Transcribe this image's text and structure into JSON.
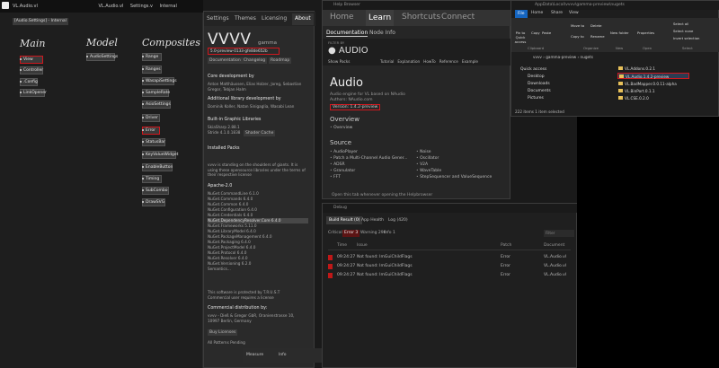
{
  "patch": {
    "tabs": [
      "VL.Audio.vl",
      "VL.Audio.vl",
      "Settings.v",
      "Internal"
    ],
    "path": "[Audio.Settings] - Internal",
    "columns": [
      "Main",
      "Model",
      "Composites"
    ],
    "main_nodes": [
      "View",
      "Controller",
      ".Config",
      "LinkOpener"
    ],
    "model_nodes": [
      "AudioSettings"
    ],
    "composite_nodes": [
      "Range",
      "Ranges",
      "WasapiSettings",
      "SampleRate",
      "AsioSettings",
      "Driver",
      "Error",
      "StatusBar",
      "KeyValueWidget",
      "EnableButton",
      "Timing",
      "SubCombo",
      "DrawSVG"
    ]
  },
  "about": {
    "tabs": [
      "Settings",
      "Themes",
      "Licensing",
      "About"
    ],
    "logo": "VVVV",
    "edition": "gamma",
    "version": "5.0-preview-0133-gfe8de652b",
    "links": [
      "Documentation",
      "Changelog",
      "Roadmap"
    ],
    "core_dev_heading": "Core development by",
    "core_dev": "Anton Matthäussen, Elias Holzer, Joreg, Sebastian Gregor, Tebjan Halm",
    "additional_heading": "Additional library development by",
    "additional": "Dominik Koller, Natan Sinigaglia, Wasabi Lean",
    "graphics_heading": "Built-in Graphic Libraries",
    "graphics": [
      "SkiaSharp   2.88.1",
      "Stride   4.1.0.1838"
    ],
    "shader_cache": "Shader Cache",
    "packs_heading": "Installed Packs",
    "standing": "vvvv is standing on the shoulders of giants. It is using these opensource libraries under the terms of their respective license",
    "license": "Apache-2.0",
    "packages": [
      "NuGet.CommandLine  6.1.0",
      "NuGet.Commands  6.4.0",
      "NuGet.Common  6.4.0",
      "NuGet.Configuration  6.4.0",
      "NuGet.Credentials  6.4.0",
      "NuGet.DependencyResolver.Core  6.4.0",
      "NuGet.Frameworks  5.11.0",
      "NuGet.LibraryModel  6.4.0",
      "NuGet.PackageManagement  6.4.0",
      "NuGet.Packaging  6.4.0",
      "NuGet.ProjectModel  6.4.0",
      "NuGet.Protocol  6.4.0",
      "NuGet.Resolver  6.4.0",
      "NuGet.Versioning  6.2.0",
      "Semantics..."
    ],
    "protected": "This software is protected by T.R.U.S.T",
    "commercial": "Commercial user requires a license",
    "distribution_heading": "Commercial distribution by:",
    "distribution": "vvvv - Dieß & Gregor GbR, Oranienstrasse 10, 10997 Berlin, Germany",
    "buy": "Buy Licenses",
    "patterns": "All Patterns Pending"
  },
  "help": {
    "window_title": "Help Browser",
    "nav": [
      "Home",
      "Learn",
      "Shortcuts",
      "Connect"
    ],
    "subnav": [
      "Documentation",
      "Node Info"
    ],
    "filtered_label": "FILTER BY",
    "filter_title": "AUDIO",
    "filter_sub": "Show Packs",
    "filter_tags": [
      "Tutorial",
      "Explanation",
      "HowTo",
      "Reference",
      "Example"
    ],
    "title": "Audio",
    "desc1": "Audio engine for VL based on NAudio",
    "desc2": "Authors: NAudio.com",
    "version": "Version: 1.4.2-preview",
    "overview_heading": "Overview",
    "overview_item": "Overview",
    "source_heading": "Source",
    "source_left": [
      "AudioPlayer",
      "Patch a Multi-Channel Audio Gener...",
      "ADSR",
      "Granulator",
      "FFT"
    ],
    "source_right": [
      "Noise",
      "Oscillator",
      "V2A",
      "WaveTable",
      "StepSequencer and ValueSequence"
    ],
    "footer": "Open this tab whenever opening the Helpbrowser"
  },
  "debug": {
    "window_title": "Debug",
    "tabs": [
      "Build Result (0)",
      "App Health",
      "Log (420)"
    ],
    "filters": [
      "Critical",
      "Error 3",
      "Warning 290",
      "Info 1"
    ],
    "search_placeholder": "Filter",
    "columns": [
      "Time",
      "Issue",
      "Patch",
      "Document"
    ],
    "rows": [
      {
        "time": "09:24:27",
        "issue": "Not found: ImGuiChildFlags",
        "patch": "Error",
        "document": "VL.Audio.vl"
      },
      {
        "time": "09:24:27",
        "issue": "Not found: ImGuiChildFlags",
        "patch": "Error",
        "document": "VL.Audio.vl"
      },
      {
        "time": "09:24:27",
        "issue": "Not found: ImGuiChildFlags",
        "patch": "Error",
        "document": "VL.Audio.vl"
      }
    ]
  },
  "explorer": {
    "title": "AppData\\Local\\vvvv\\gamma-preview\\nugets",
    "ribbon_tabs": [
      "File",
      "Home",
      "Share",
      "View"
    ],
    "buttons": [
      "Pin to Quick access",
      "Copy",
      "Paste",
      "Move to",
      "Copy to",
      "Delete",
      "Rename",
      "New folder",
      "Properties",
      "Select all",
      "Select none",
      "Invert selection"
    ],
    "groups": [
      "Clipboard",
      "Organize",
      "New",
      "Open",
      "Select"
    ],
    "address": "vvvv  ›  gamma-preview  ›  nugets",
    "nav": [
      "Quick access",
      "Desktop",
      "Downloads",
      "Documents",
      "Pictures"
    ],
    "files": [
      "VL.Addons.0.2.1",
      "VL.Audio.1.4.2-preview",
      "VL.BadMapper.0.0.11-alpha",
      "VL.BinPort.0.1.1",
      "VL.CSE.0.2.0"
    ],
    "status": "222 items    1 item selected"
  },
  "bottom": {
    "items": [
      "Measure",
      "Info"
    ]
  }
}
